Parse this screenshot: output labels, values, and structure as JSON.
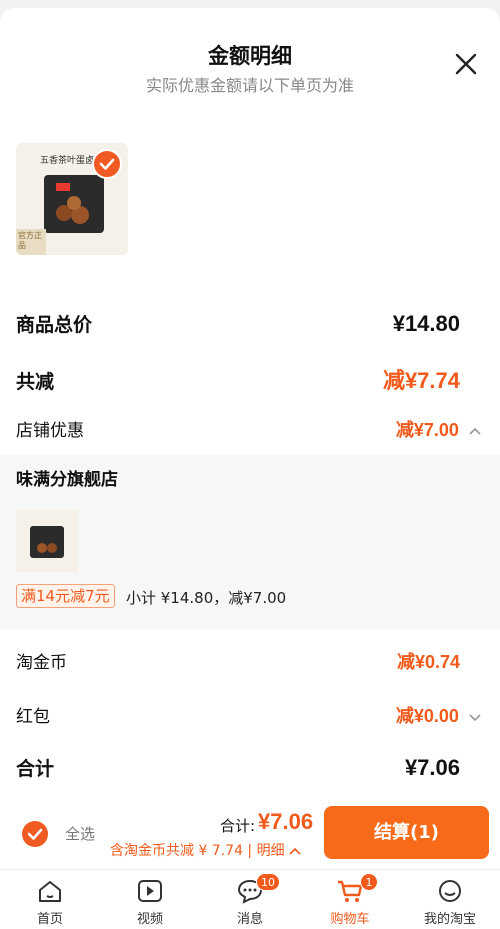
{
  "header": {
    "title": "金额明细",
    "subtitle": "实际优惠金额请以下单页为准"
  },
  "product": {
    "image_caption": "五香茶叶蛋卤料包",
    "badge": "官方正品"
  },
  "summary": {
    "total_label": "商品总价",
    "total_value": "¥14.80",
    "discount_label": "共减",
    "discount_value": "减¥7.74",
    "shop_discount_label": "店铺优惠",
    "shop_discount_value": "减¥7.00",
    "coin_label": "淘金币",
    "coin_value": "减¥0.74",
    "redpacket_label": "红包",
    "redpacket_value": "减¥0.00",
    "sum_label": "合计",
    "sum_value": "¥7.06"
  },
  "store": {
    "name": "味满分旗舰店",
    "promo_tag": "满14元减7元",
    "subtotal": "小计 ¥14.80，减¥7.00"
  },
  "bottom_bar": {
    "select_all": "全选",
    "total_label": "合计:",
    "total_value": "¥7.06",
    "note": "含淘金币共减 ¥ 7.74 | 明细",
    "checkout": "结算(1)"
  },
  "tabs": [
    {
      "label": "首页",
      "icon": "home-icon"
    },
    {
      "label": "视频",
      "icon": "video-icon"
    },
    {
      "label": "消息",
      "icon": "message-icon",
      "badge": "10"
    },
    {
      "label": "购物车",
      "icon": "cart-icon",
      "badge": "1",
      "active": true
    },
    {
      "label": "我的淘宝",
      "icon": "profile-icon"
    }
  ],
  "colors": {
    "accent": "#f25a1b",
    "button": "#f76a1a"
  }
}
